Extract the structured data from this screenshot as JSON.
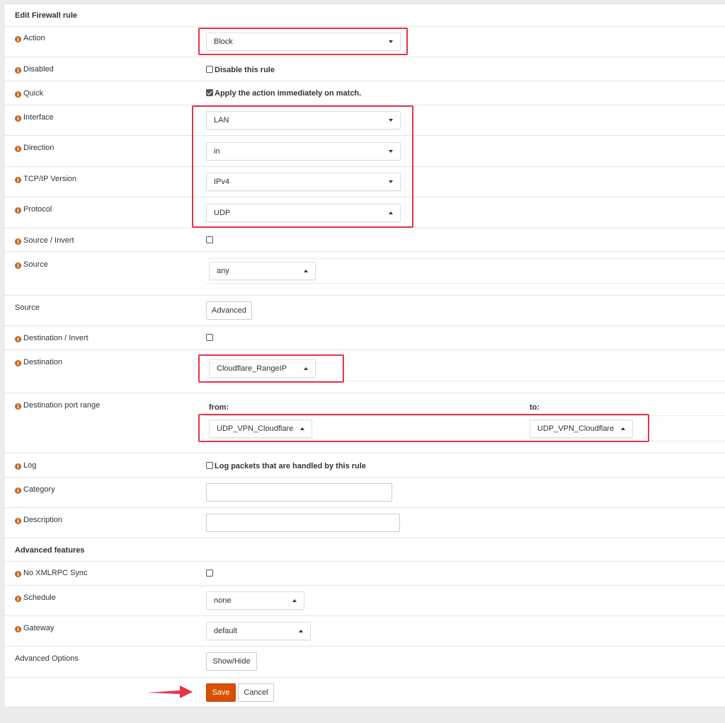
{
  "header": {
    "title": "Edit Firewall rule"
  },
  "rows": {
    "action": {
      "label": "Action",
      "value": "Block"
    },
    "disabled": {
      "label": "Disabled",
      "checkbox_label": "Disable this rule",
      "checked": false
    },
    "quick": {
      "label": "Quick",
      "checkbox_label": "Apply the action immediately on match.",
      "checked": true
    },
    "interface": {
      "label": "Interface",
      "value": "LAN"
    },
    "direction": {
      "label": "Direction",
      "value": "in"
    },
    "ipversion": {
      "label": "TCP/IP Version",
      "value": "IPv4"
    },
    "protocol": {
      "label": "Protocol",
      "value": "UDP"
    },
    "source_invert": {
      "label": "Source / Invert",
      "checked": false
    },
    "source": {
      "label": "Source",
      "value": "any"
    },
    "source_adv": {
      "label": "Source",
      "button": "Advanced"
    },
    "dest_invert": {
      "label": "Destination / Invert",
      "checked": false
    },
    "destination": {
      "label": "Destination",
      "value": "Cloudflare_RangeIP"
    },
    "dest_port": {
      "label": "Destination port range",
      "from_label": "from:",
      "to_label": "to:",
      "from_value": "UDP_VPN_Cloudflare",
      "to_value": "UDP_VPN_Cloudflare"
    },
    "log": {
      "label": "Log",
      "checkbox_label": "Log packets that are handled by this rule",
      "checked": false
    },
    "category": {
      "label": "Category",
      "value": ""
    },
    "description": {
      "label": "Description",
      "value": ""
    }
  },
  "advanced": {
    "title": "Advanced features",
    "no_xmlrpc": {
      "label": "No XMLRPC Sync",
      "checked": false
    },
    "schedule": {
      "label": "Schedule",
      "value": "none"
    },
    "gateway": {
      "label": "Gateway",
      "value": "default"
    },
    "options": {
      "label": "Advanced Options",
      "button": "Show/Hide"
    }
  },
  "actions": {
    "save": "Save",
    "cancel": "Cancel"
  },
  "icons": {
    "info": "info-icon",
    "arrow": "arrow-right-icon"
  },
  "colors": {
    "accent": "#d94f00",
    "highlight": "#e8334a",
    "info": "#c0651c"
  }
}
